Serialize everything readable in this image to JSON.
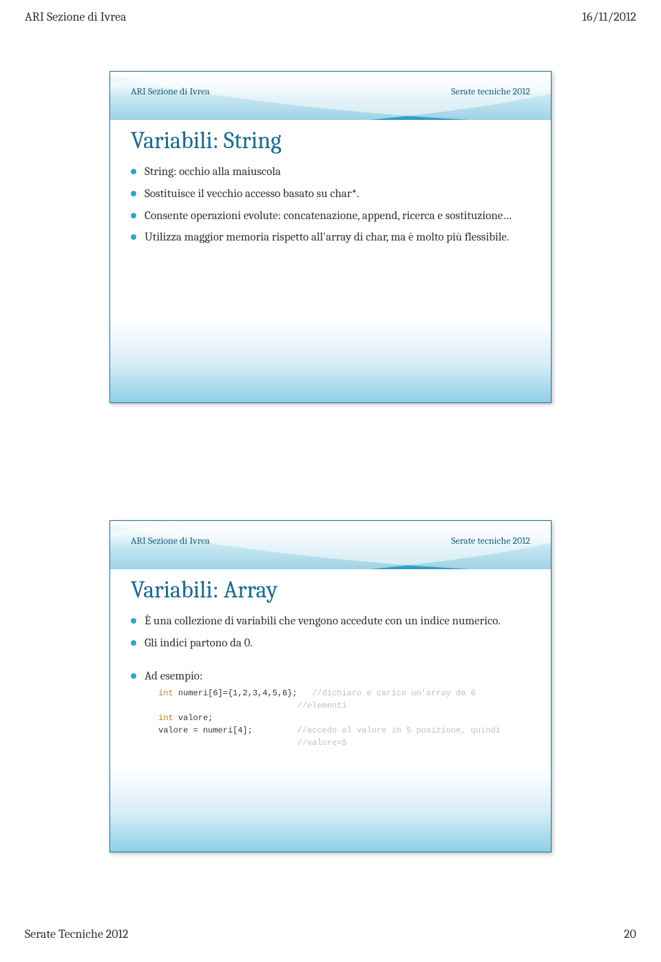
{
  "top": {
    "left": "ARI Sezione di Ivrea",
    "right": "16/11/2012"
  },
  "slide_header": {
    "left": "ARI Sezione di Ivrea",
    "right": "Serate tecniche 2012"
  },
  "slide1": {
    "title": "Variabili: String",
    "b1": "String: occhio alla maiuscola",
    "b2": "Sostituisce il vecchio accesso basato su char*.",
    "b3": "Consente operazioni evolute: concatenazione, append, ricerca e sostituzione…",
    "b4": "Utilizza maggior memoria rispetto all'array di char, ma è molto più flessibile."
  },
  "slide2": {
    "title": "Variabili: Array",
    "b1": "È una collezione di variabili che vengono accedute con un indice numerico.",
    "b2": "Gli indici partono da 0.",
    "b3": "Ad esempio:",
    "code": {
      "kw_int": "int",
      "line1a": " numeri[6]={1,2,3,4,5,6};   ",
      "line1c": "//dichiaro e carico un'array da 6",
      "line1c2": "//elementi",
      "line2a": " valore;",
      "line3a": "valore = numeri[4];         ",
      "line3c": "//accedo al valore in 5 posizione, quindi",
      "line3c2": "//valore=5"
    }
  },
  "footer": {
    "left": "Serate Tecniche 2012",
    "right": "20"
  }
}
